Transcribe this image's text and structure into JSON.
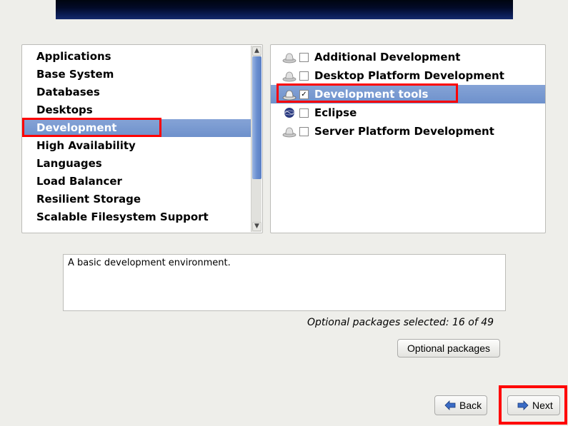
{
  "categories": [
    {
      "label": "Applications",
      "selected": false
    },
    {
      "label": "Base System",
      "selected": false
    },
    {
      "label": "Databases",
      "selected": false
    },
    {
      "label": "Desktops",
      "selected": false
    },
    {
      "label": "Development",
      "selected": true
    },
    {
      "label": "High Availability",
      "selected": false
    },
    {
      "label": "Languages",
      "selected": false
    },
    {
      "label": "Load Balancer",
      "selected": false
    },
    {
      "label": "Resilient Storage",
      "selected": false
    },
    {
      "label": "Scalable Filesystem Support",
      "selected": false
    }
  ],
  "packages": [
    {
      "label": "Additional Development",
      "checked": false,
      "selected": false,
      "icon": "hat"
    },
    {
      "label": "Desktop Platform Development",
      "checked": false,
      "selected": false,
      "icon": "hat"
    },
    {
      "label": "Development tools",
      "checked": true,
      "selected": true,
      "icon": "hat"
    },
    {
      "label": "Eclipse",
      "checked": false,
      "selected": false,
      "icon": "globe"
    },
    {
      "label": "Server Platform Development",
      "checked": false,
      "selected": false,
      "icon": "hat"
    }
  ],
  "description": "A basic development environment.",
  "optional_status": "Optional packages selected: 16 of 49",
  "buttons": {
    "optional": "Optional packages",
    "back": "Back",
    "next": "Next"
  }
}
